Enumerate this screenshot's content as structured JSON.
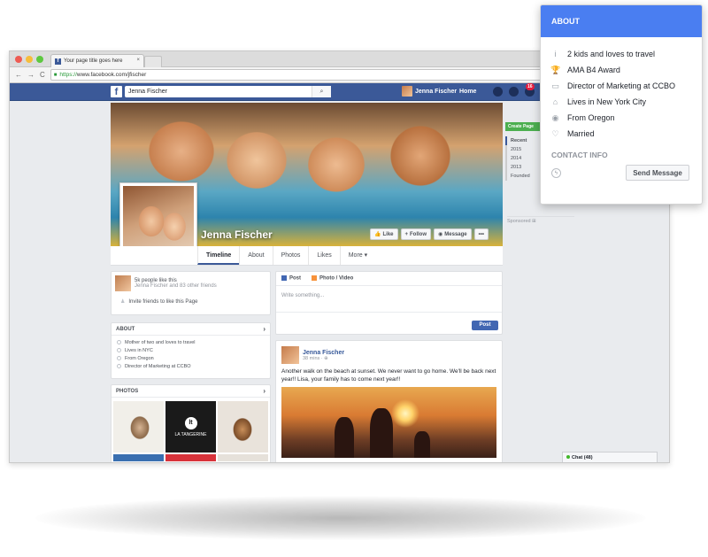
{
  "browser": {
    "tab_title": "Your page title goes here",
    "tab_favicon": "f",
    "url_prefix": "https://",
    "url_rest": "www.facebook.com/jfischer"
  },
  "fbbar": {
    "logo": "f",
    "search_value": "Jenna Fischer",
    "user_name": "Jenna Fischer",
    "home": "Home",
    "notif_count": "16"
  },
  "profile": {
    "name": "Jenna Fischer",
    "btn_like": "Like",
    "btn_follow": "Follow",
    "btn_message": "Message",
    "btn_more": "•••"
  },
  "tabs": [
    "Timeline",
    "About",
    "Photos",
    "Likes",
    "More ▾"
  ],
  "likes_card": {
    "title": "5k people like this",
    "subtitle": "Jenna Fischer and 83 other friends",
    "invite": "Invite friends to like this Page"
  },
  "about_card": {
    "title": "ABOUT",
    "items": [
      "Mother of two and loves to travel",
      "Lives in NYC",
      "From Oregon",
      "Director of Marketing at CCBO"
    ]
  },
  "photos_card": {
    "title": "PHOTOS",
    "brand_name": "LA TANGERINE",
    "brand_mark": "lt"
  },
  "composer": {
    "tab_post": "Post",
    "tab_photo": "Photo / Video",
    "placeholder": "Write something...",
    "post_button": "Post"
  },
  "feed_post": {
    "author": "Jenna Fischer",
    "time": "38 mins · ",
    "text": "Another walk on the beach at sunset. We never want to go home. We'll be back next year!! Lisa, your family has to come next year!!"
  },
  "right_col": {
    "create_page": "Create Page",
    "years": [
      "Recent",
      "2015",
      "2014",
      "2013",
      "Founded"
    ],
    "sponsored": "Sponsored"
  },
  "chat": {
    "label": "Chat (48)"
  },
  "popup": {
    "title": "ABOUT",
    "items": [
      {
        "icon": "info-icon",
        "glyph": "i",
        "text": "2 kids and loves to travel"
      },
      {
        "icon": "trophy-icon",
        "glyph": "🏆",
        "text": "AMA B4 Award"
      },
      {
        "icon": "briefcase-icon",
        "glyph": "▭",
        "text": "Director of Marketing at CCBO"
      },
      {
        "icon": "home-icon",
        "glyph": "⌂",
        "text": "Lives in New York City"
      },
      {
        "icon": "location-pin-icon",
        "glyph": "◉",
        "text": "From Oregon"
      },
      {
        "icon": "heart-icon",
        "glyph": "♡",
        "text": "Married"
      }
    ],
    "contact_title": "CONTACT INFO",
    "send_message": "Send Message"
  },
  "colors": {
    "fb_blue": "#3b5998",
    "popup_header": "#4a7ef1",
    "post_button": "#4267b2",
    "create_page": "#4caf50"
  }
}
